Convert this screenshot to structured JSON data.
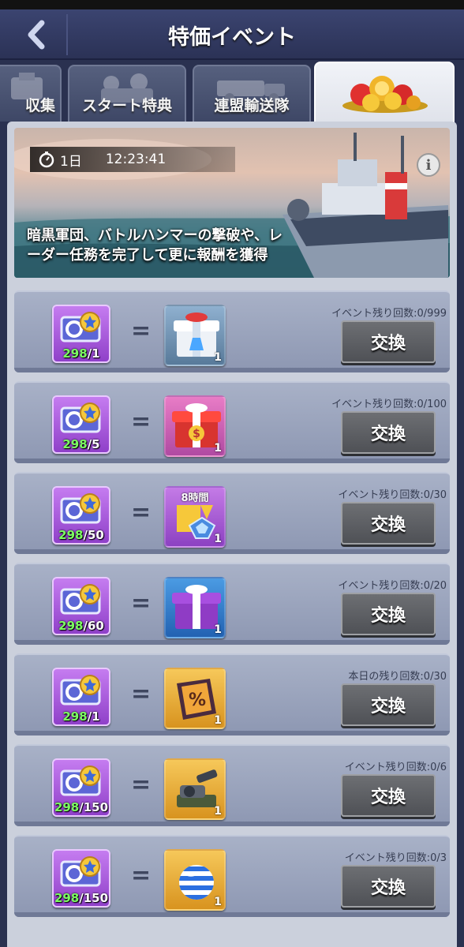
{
  "header": {
    "title": "特価イベント"
  },
  "tabs": [
    {
      "label": "収集"
    },
    {
      "label": "スタート特典"
    },
    {
      "label": "連盟輸送隊"
    },
    {
      "label": ""
    }
  ],
  "banner": {
    "timer_days": "1日",
    "timer_time": "12:23:41",
    "info": "i",
    "description_line1": "暗黒軍団、バトルハンマーの撃破や、レ",
    "description_line2": "ーダー任務を完了して更に報酬を獲得"
  },
  "exchange_label": "交換",
  "equals": "=",
  "rows": [
    {
      "owned": "298",
      "cost": "/1",
      "reward": "lab-crate",
      "reward_qty": "1",
      "remain": "イベント残り回数:0/999"
    },
    {
      "owned": "298",
      "cost": "/5",
      "reward": "resource-crate",
      "reward_qty": "1",
      "remain": "イベント残り回数:0/100"
    },
    {
      "owned": "298",
      "cost": "/50",
      "reward": "speedup-8h",
      "reward_top": "8時間",
      "reward_qty": "1",
      "remain": "イベント残り回数:0/30"
    },
    {
      "owned": "298",
      "cost": "/60",
      "reward": "purple-crate",
      "reward_qty": "1",
      "remain": "イベント残り回数:0/20"
    },
    {
      "owned": "298",
      "cost": "/1",
      "reward": "discount-coupon",
      "reward_qty": "1",
      "remain": "本日の残り回数:0/30"
    },
    {
      "owned": "298",
      "cost": "/150",
      "reward": "cannon",
      "reward_qty": "1",
      "remain": "イベント残り回数:0/6"
    },
    {
      "owned": "298",
      "cost": "/150",
      "reward": "striped-orb",
      "reward_qty": "1",
      "remain": "イベント残り回数:0/3"
    }
  ]
}
